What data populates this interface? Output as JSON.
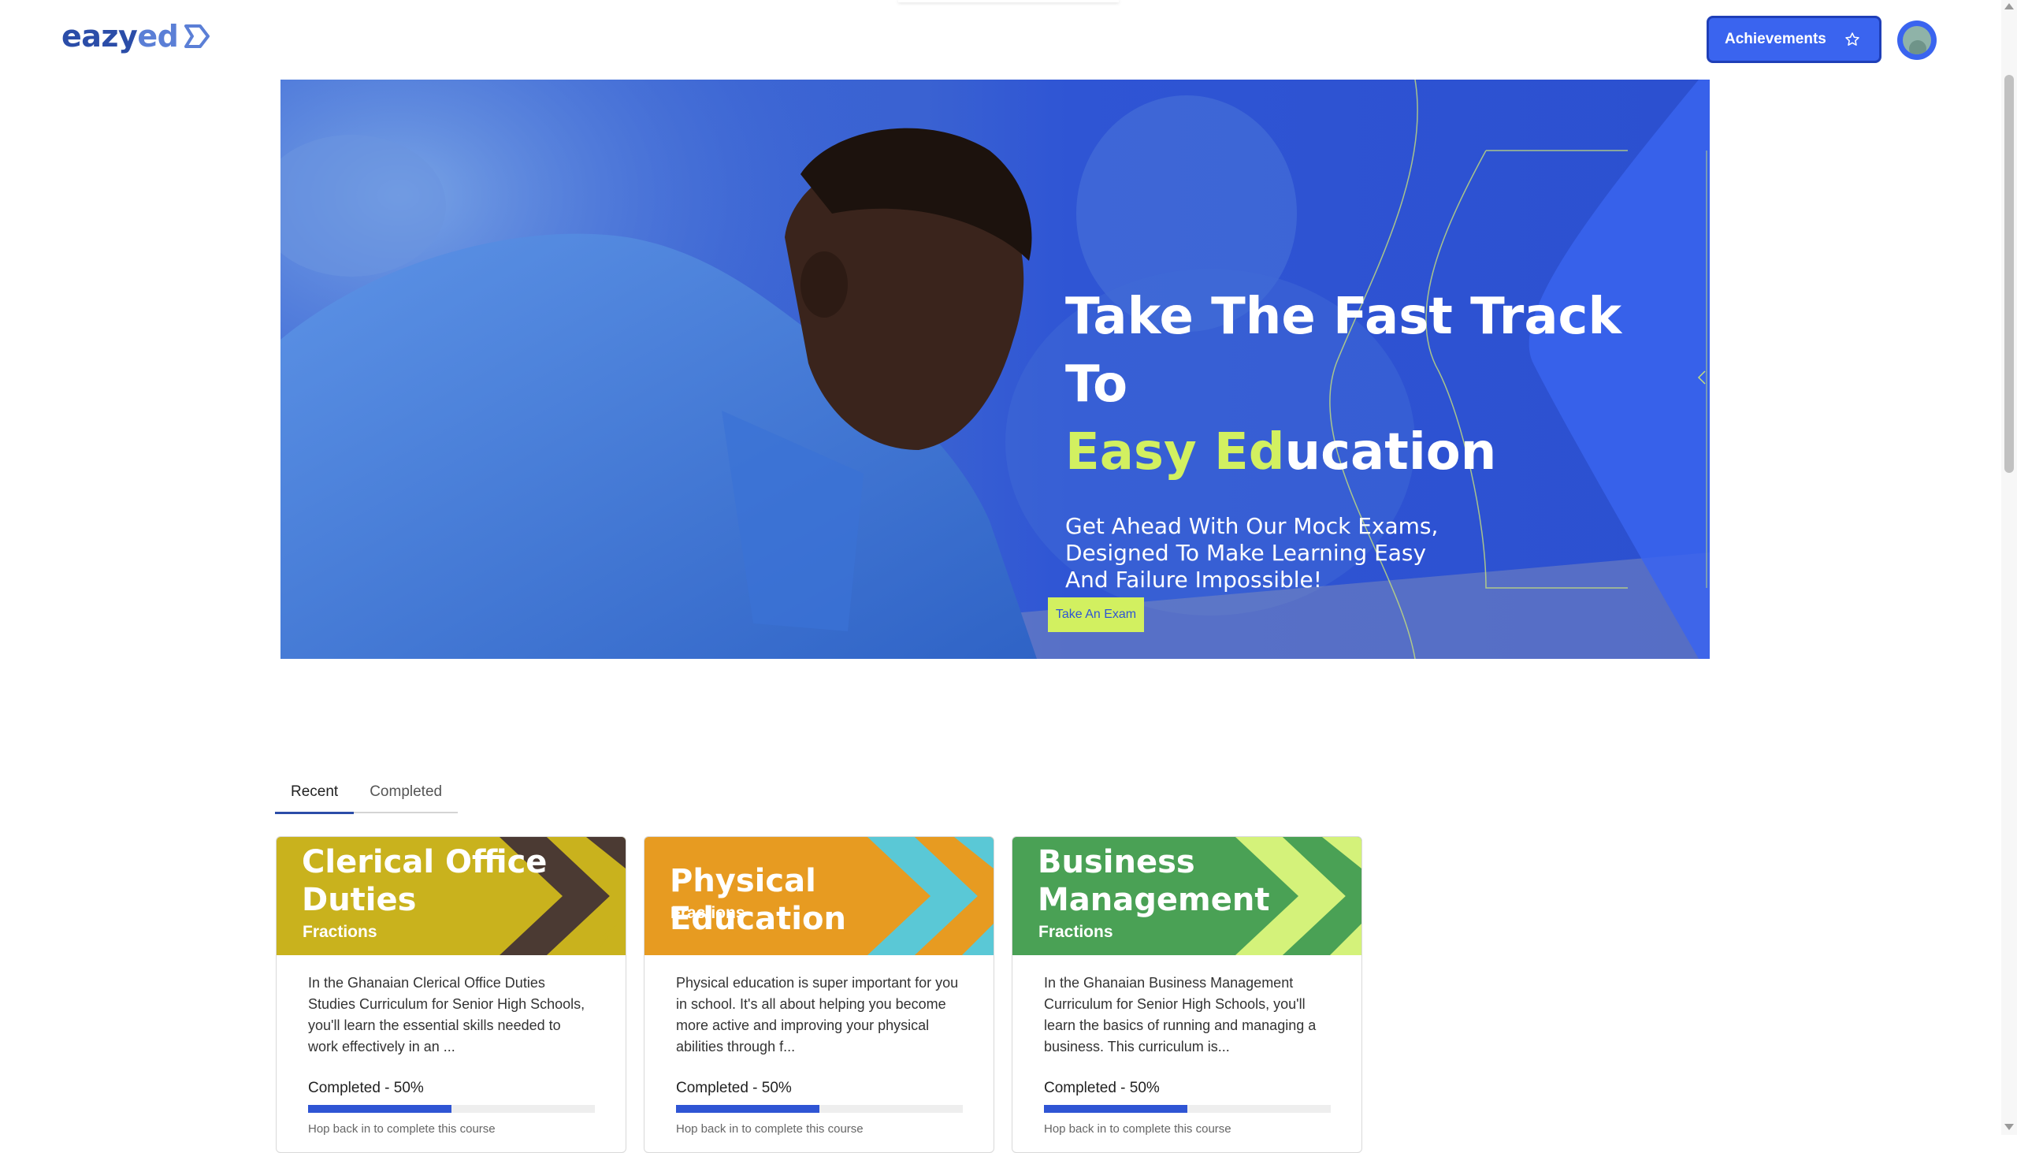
{
  "header": {
    "logo": {
      "eazy": "eazy",
      "ed": "ed"
    },
    "achievements_label": "Achievements",
    "achievements_icon": "star-icon",
    "avatar": "user-avatar"
  },
  "hero": {
    "title_line1": "Take The Fast Track To",
    "title_accent": "Easy Ed",
    "title_rest": "ucation",
    "subtitle": "Get Ahead With Our Mock Exams, Designed To Make Learning Easy And Failure Impossible!",
    "cta": "Take An Exam",
    "colors": {
      "blue": "#2f55d4",
      "accent": "#d2f060"
    }
  },
  "tabs": [
    {
      "label": "Recent",
      "active": true
    },
    {
      "label": "Completed",
      "active": false
    }
  ],
  "courses": [
    {
      "title": "Clerical Office Duties",
      "subtitle": "Fractions",
      "description": "In the Ghanaian Clerical Office Duties Studies Curriculum for Senior High Schools, you'll learn the essential skills needed to work effectively in an ...",
      "progress_label": "Completed - 50%",
      "progress": 0.5,
      "footer": "Hop back in to complete this course",
      "color": "#c9b21d"
    },
    {
      "title": "Physical Education",
      "subtitle": "Fractions",
      "description": "Physical education is super important for you in school. It's all about helping you become more active and improving your physical abilities through f...",
      "progress_label": "Completed - 50%",
      "progress": 0.5,
      "footer": "Hop back in to complete this course",
      "color": "#e79b21"
    },
    {
      "title": "Business Management",
      "subtitle": "Fractions",
      "description": "In the Ghanaian Business Management Curriculum for Senior High Schools, you'll learn the basics of running and managing a business. This curriculum is...",
      "progress_label": "Completed - 50%",
      "progress": 0.5,
      "footer": "Hop back in to complete this course",
      "color": "#4aa155"
    }
  ]
}
